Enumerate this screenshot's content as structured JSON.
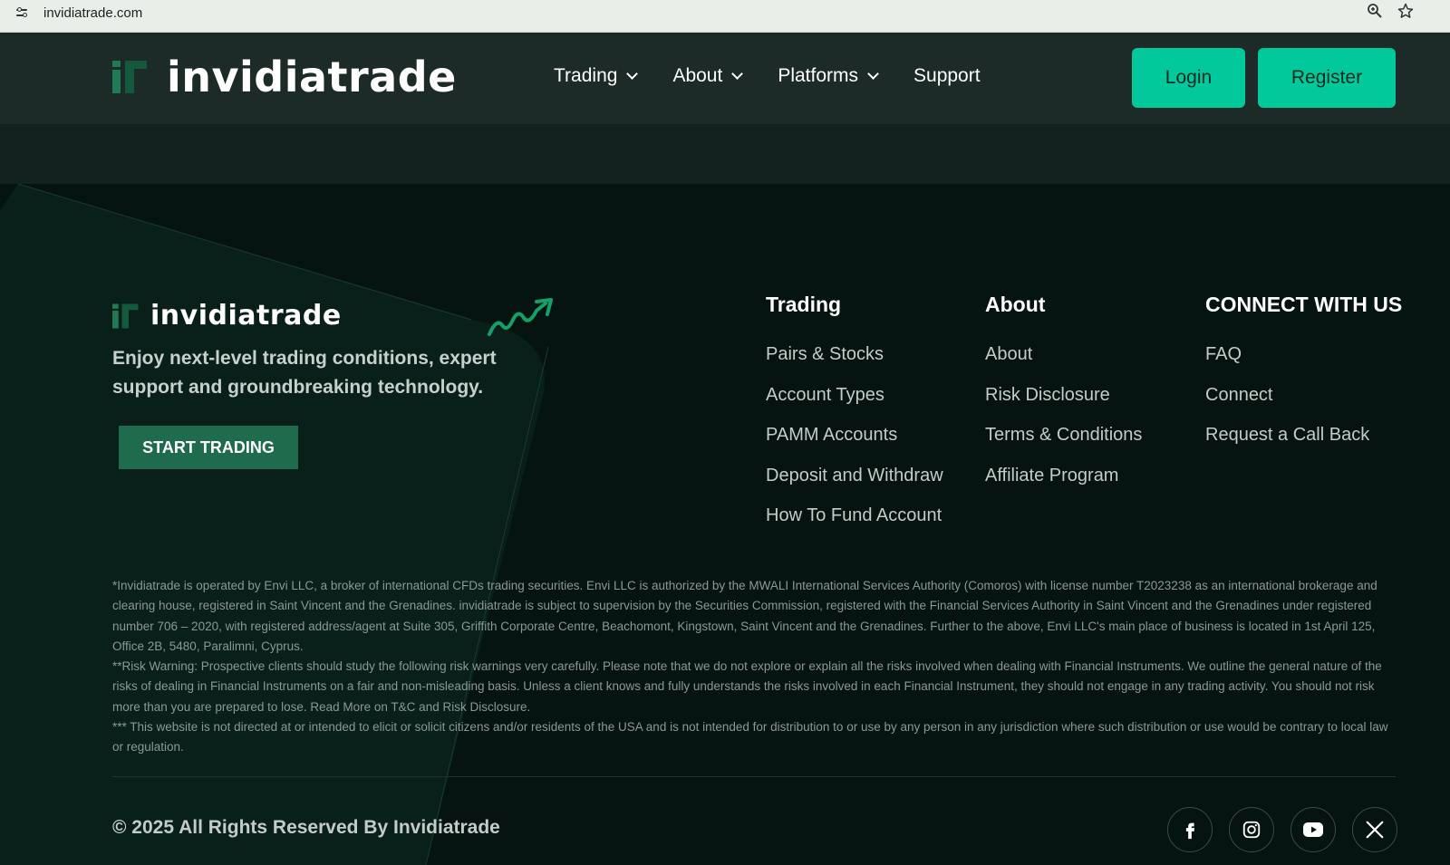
{
  "browser": {
    "url": "invidiatrade.com",
    "icons": [
      "site-settings-icon",
      "zoom-icon",
      "bookmark-star-icon"
    ]
  },
  "header": {
    "logo_text": "invidiatrade",
    "nav": [
      {
        "label": "Trading",
        "has_dropdown": true
      },
      {
        "label": "About",
        "has_dropdown": true
      },
      {
        "label": "Platforms",
        "has_dropdown": true
      },
      {
        "label": "Support",
        "has_dropdown": false
      }
    ],
    "login_label": "Login",
    "register_label": "Register"
  },
  "footer": {
    "logo_text": "invidiatrade",
    "tagline": "Enjoy next-level trading conditions, expert support and groundbreaking technology.",
    "start_trading_label": "START TRADING",
    "columns": [
      {
        "title": "Trading",
        "links": [
          "Pairs & Stocks",
          "Account Types",
          "PAMM Accounts",
          "Deposit and Withdraw",
          "How To Fund Account"
        ]
      },
      {
        "title": "About",
        "links": [
          "About",
          "Risk Disclosure",
          "Terms & Conditions",
          "Affiliate Program"
        ]
      },
      {
        "title": "CONNECT WITH US",
        "links": [
          "FAQ",
          "Connect",
          "Request a Call Back"
        ]
      }
    ],
    "legal": [
      "*Invidiatrade is operated by Envi LLC, a broker of international CFDs trading securities. Envi LLC is authorized by the MWALI International Services Authority (Comoros) with license number T2023238 as an international brokerage and clearing house, registered in Saint Vincent and the Grenadines. invidiatrade is subject to supervision by the Securities Commission, registered with the Financial Services Authority in Saint Vincent and the Grenadines under registered number 706 – 2020, with registered address/agent at Suite 305, Griffith Corporate Centre, Beachomont, Kingstown, Saint Vincent and the Grenadines. Further to the above, Envi LLC's main place of business is located in 1st April 125, Office 2B, 5480, Paralimni, Cyprus.",
      "**Risk Warning: Prospective clients should study the following risk warnings very carefully. Please note that we do not explore or explain all the risks involved when dealing with Financial Instruments. We outline the general nature of the risks of dealing in Financial Instruments on a fair and non-misleading basis. Unless a client knows and fully understands the risks involved in each Financial Instrument, they should not engage in any trading activity. You should not risk more than you are prepared to lose. Read More on T&C and Risk Disclosure.",
      "*** This website is not directed at or intended to elicit or solicit citizens and/or residents of the USA and is not intended for distribution to or use by any person in any jurisdiction where such distribution or use would be contrary to local law or regulation."
    ],
    "copyright": "© 2025 All Rights Reserved By Invidiatrade",
    "socials": [
      "facebook-icon",
      "instagram-icon",
      "youtube-icon",
      "x-icon"
    ]
  },
  "colors": {
    "accent": "#02c99b",
    "header_bg": "#1c2b27",
    "footer_bg": "#051410",
    "cta_dark_green": "#1f6b4e"
  }
}
